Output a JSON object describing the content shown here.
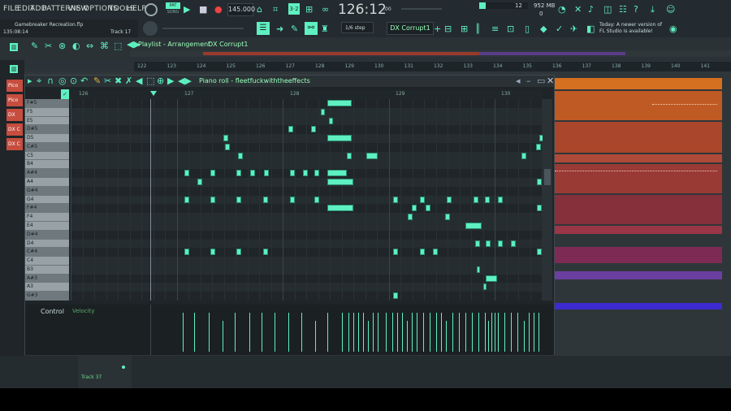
{
  "menu": [
    "FILE",
    "EDIT",
    "ADD",
    "PATTERNS",
    "VIEW",
    "OPTIONS",
    "TOOLS",
    "HELP"
  ],
  "transport": {
    "pat_label": "PAT",
    "song_label": "SONG",
    "tempo": "145.000",
    "time": "126:12",
    "time_small": ":00",
    "beats": "B:S:T"
  },
  "stats": {
    "cpu": "12",
    "memory": "952 MB",
    "voices": "0"
  },
  "project": {
    "file": "Gamebreaker Recreation.flp",
    "position": "135:08:14",
    "track": "Track 17"
  },
  "snap": {
    "label": "1/6 step",
    "pattern": "DX Corrupt1"
  },
  "news": {
    "line1": "Today: A newer version of",
    "line2": "FL Studio is available!"
  },
  "playlist": {
    "title": "Playlist - Arrangement",
    "pattern": "DX Corrupt1"
  },
  "ruler": [
    "122",
    "123",
    "124",
    "125",
    "126",
    "127",
    "128",
    "129",
    "130",
    "131",
    "132",
    "133",
    "134",
    "135",
    "136",
    "137",
    "138",
    "139",
    "140",
    "141"
  ],
  "channels": [
    "Pico",
    "Pico",
    "DX",
    "DX C",
    "DX C"
  ],
  "piano_roll": {
    "title": "Piano roll - fleetfuckwiththeeffects",
    "ruler": [
      "126",
      "127",
      "128",
      "129",
      "130"
    ],
    "keys": [
      "F#5",
      "F5",
      "E5",
      "D#5",
      "D5",
      "C#5",
      "C5",
      "B4",
      "A#4",
      "A4",
      "G#4",
      "G4",
      "F#4",
      "F4",
      "E4",
      "D#4",
      "D4",
      "C#4",
      "C4",
      "B3",
      "A#3",
      "A3",
      "G#3"
    ],
    "control_label": "Control",
    "control_param": "Velocity"
  },
  "bottom_track": "Track 37",
  "colors": {
    "accent": "#5ef0c0",
    "bg": "#2b3338",
    "note": "#5ef0c0"
  }
}
